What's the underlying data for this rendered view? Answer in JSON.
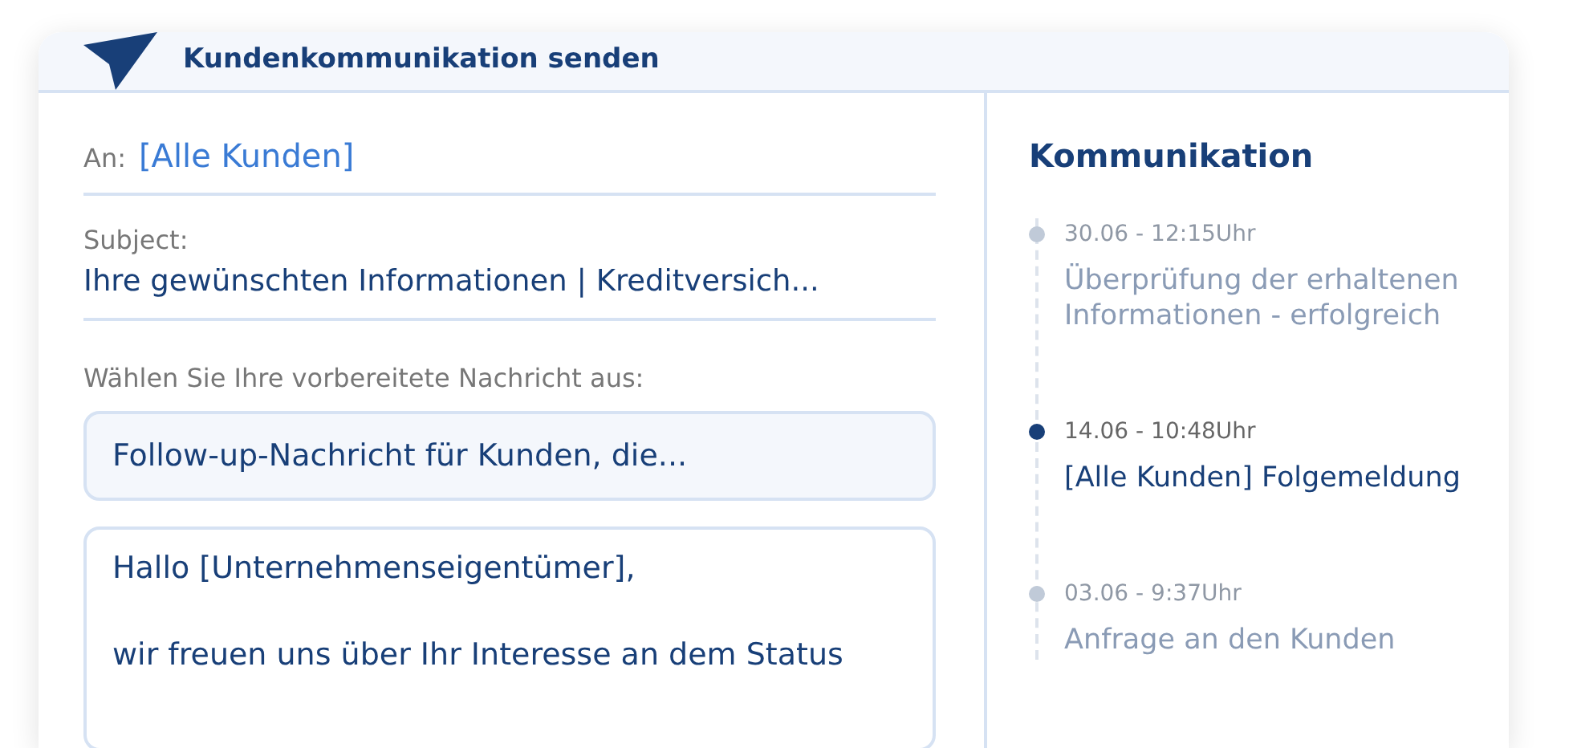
{
  "header": {
    "title": "Kundenkommunikation senden"
  },
  "compose": {
    "to_label": "An:",
    "to_value": "[Alle Kunden]",
    "subject_label": "Subject:",
    "subject_value": "Ihre gewünschten Informationen | Kreditversich...",
    "template_label": "Wählen Sie Ihre vorbereitete Nachricht aus:",
    "template_value": "Follow-up-Nachricht für Kunden, die...",
    "message_lines": [
      "Hallo [Unternehmenseigentümer],",
      "wir freuen uns über Ihr Interesse an dem Status"
    ]
  },
  "timeline": {
    "title": "Kommunikation",
    "items": [
      {
        "time": "30.06 - 12:15Uhr",
        "text": "Überprüfung der erhaltenen Informationen - erfolgreich",
        "selected": false
      },
      {
        "time": "14.06 - 10:48Uhr",
        "text": "[Alle Kunden] Folgemeldung",
        "selected": true
      },
      {
        "time": "03.06 - 9:37Uhr",
        "text": "Anfrage an den Kunden",
        "selected": false
      }
    ]
  }
}
